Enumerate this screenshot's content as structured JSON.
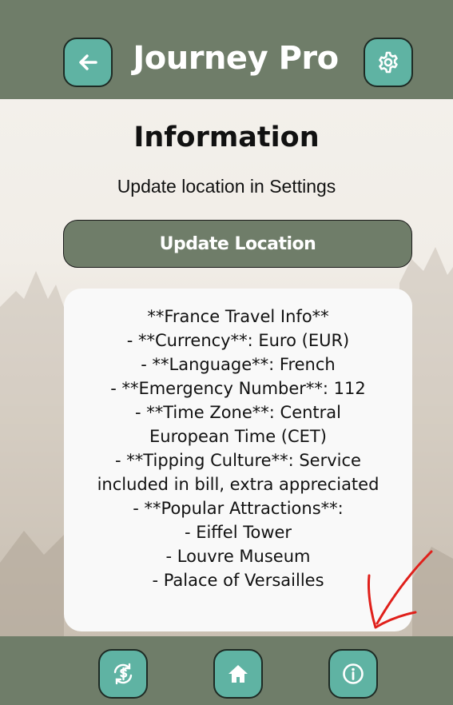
{
  "header": {
    "title": "Journey Pro",
    "back_icon": "arrow-left-icon",
    "settings_icon": "gear-icon"
  },
  "main": {
    "page_title": "Information",
    "subtitle": "Update location in Settings",
    "update_button_label": "Update Location"
  },
  "info": {
    "lines": [
      "**France Travel Info**",
      "- **Currency**: Euro (EUR)",
      "- **Language**: French",
      "- **Emergency Number**: 112",
      "- **Time Zone**: Central",
      "European Time (CET)",
      "- **Tipping Culture**: Service",
      "included in bill, extra appreciated",
      "- **Popular Attractions**:",
      "- Eiffel Tower",
      "- Louvre Museum",
      "- Palace of Versailles"
    ]
  },
  "footer": {
    "items": [
      {
        "icon": "sync-dollar-icon"
      },
      {
        "icon": "home-icon"
      },
      {
        "icon": "info-icon"
      }
    ]
  },
  "colors": {
    "header_bg": "#6f7d69",
    "button_teal": "#5fb3a3",
    "content_bg": "#f2efea",
    "card_bg": "#f9f9f9",
    "annotation_red": "#e0201b"
  }
}
